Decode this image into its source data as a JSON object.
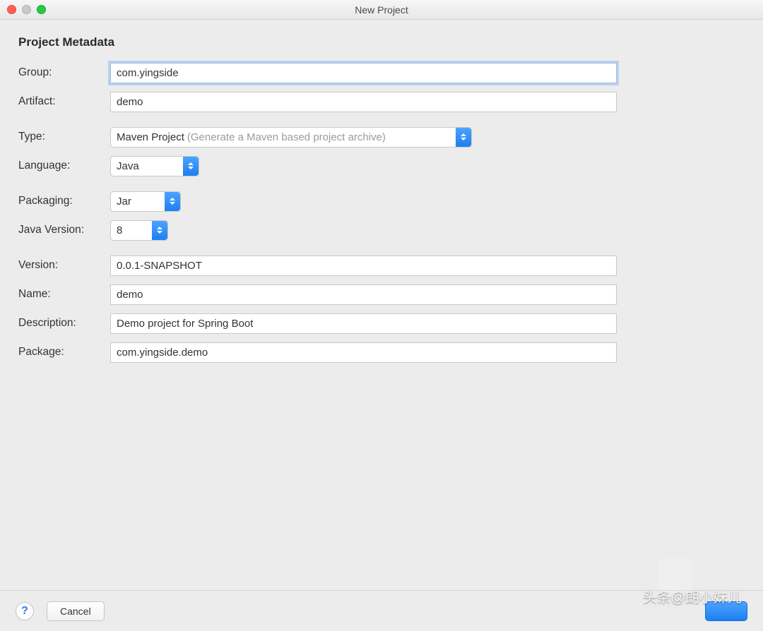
{
  "window": {
    "title": "New Project"
  },
  "section": {
    "title": "Project Metadata"
  },
  "fields": {
    "group": {
      "label": "Group:",
      "value": "com.yingside"
    },
    "artifact": {
      "label": "Artifact:",
      "value": "demo"
    },
    "type": {
      "label": "Type:",
      "value": "Maven Project",
      "hint": "(Generate a Maven based project archive)"
    },
    "language": {
      "label": "Language:",
      "value": "Java"
    },
    "packaging": {
      "label": "Packaging:",
      "value": "Jar"
    },
    "javaVersion": {
      "label": "Java Version:",
      "value": "8"
    },
    "version": {
      "label": "Version:",
      "value": "0.0.1-SNAPSHOT"
    },
    "name": {
      "label": "Name:",
      "value": "demo"
    },
    "description": {
      "label": "Description:",
      "value": "Demo project for Spring Boot"
    },
    "package": {
      "label": "Package:",
      "value": "com.yingside.demo"
    }
  },
  "footer": {
    "help": "?",
    "cancel": "Cancel"
  },
  "watermark": "头条@朗小妹儿"
}
